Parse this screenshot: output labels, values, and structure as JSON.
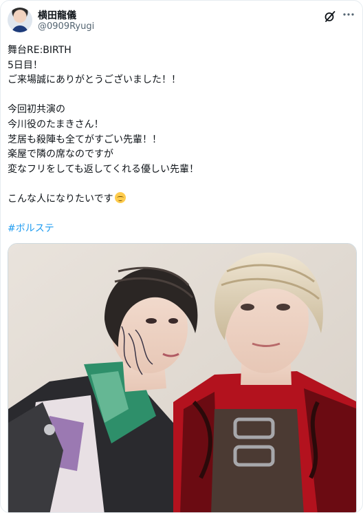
{
  "author": {
    "name": "横田龍儀",
    "handle": "@0909Ryugi"
  },
  "icons": {
    "avatar": "profile-avatar",
    "grok": "grok-icon",
    "more": "more-options-icon",
    "emoji": "relieved-face-emoji"
  },
  "post": {
    "lines": [
      "舞台RE:BIRTH",
      "5日目！",
      "ご来場誠にありがとうございました！！",
      "",
      "今回初共演の",
      "今川役のたまきさん！",
      "芝居も殺陣も全てがすごい先輩！！",
      "楽屋で隣の席なのですが",
      "変なフリをしても返してくれる優しい先輩！",
      "",
      "こんな人になりたいです",
      ""
    ],
    "hashtag": "#ボルステ"
  },
  "colors": {
    "link": "#1d9bf0",
    "text": "#0f1419",
    "secondary": "#536471"
  }
}
